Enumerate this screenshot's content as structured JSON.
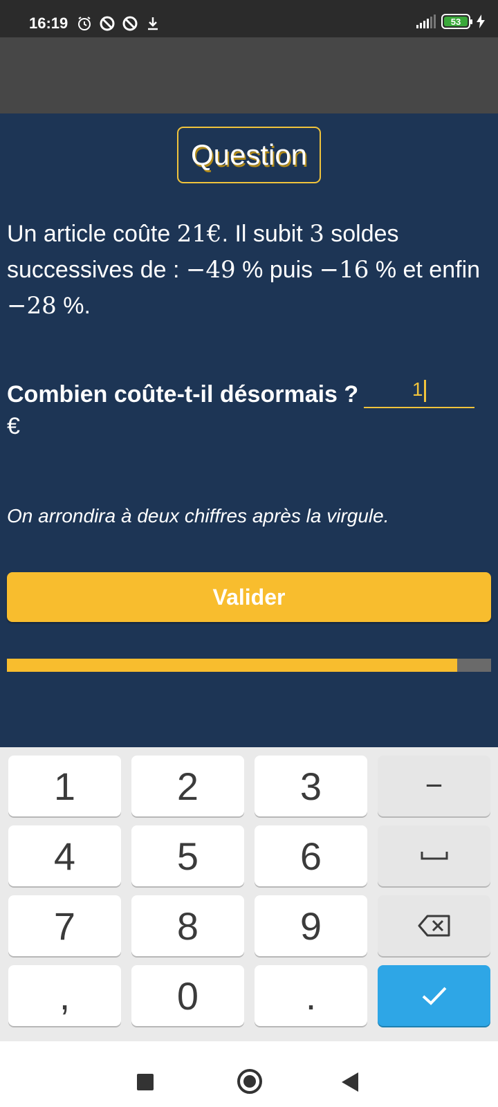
{
  "status_bar": {
    "time": "16:19",
    "battery": "53",
    "icons": [
      "alarm-icon",
      "do-not-disturb-icon",
      "do-not-disturb-icon",
      "download-icon",
      "signal-icon",
      "battery-icon",
      "charging-icon"
    ]
  },
  "question": {
    "badge": "Question",
    "text_1": "Un article coûte ",
    "price": "21€",
    "text_2": ". Il subit ",
    "count": "3",
    "text_3": " soldes successives de : ",
    "disc1": "−49",
    "text_4": " % puis ",
    "disc2": "−16",
    "text_5": " % et enfin ",
    "disc3": "−28",
    "text_6": " %."
  },
  "answer": {
    "prompt": "Combien coûte-t-il désormais ?",
    "value": "1",
    "unit": "€"
  },
  "hint": "On arrondira à deux chiffres après la virgule.",
  "submit_label": "Valider",
  "progress": 0.93,
  "keyboard": {
    "keys": [
      "1",
      "2",
      "3",
      "−",
      "4",
      "5",
      "6",
      "␣",
      "7",
      "8",
      "9",
      "⌫",
      ",",
      "0",
      ".",
      "✓"
    ]
  },
  "colors": {
    "background": "#1d3555",
    "accent": "#f8bd2e",
    "confirm": "#2ea6e6"
  }
}
